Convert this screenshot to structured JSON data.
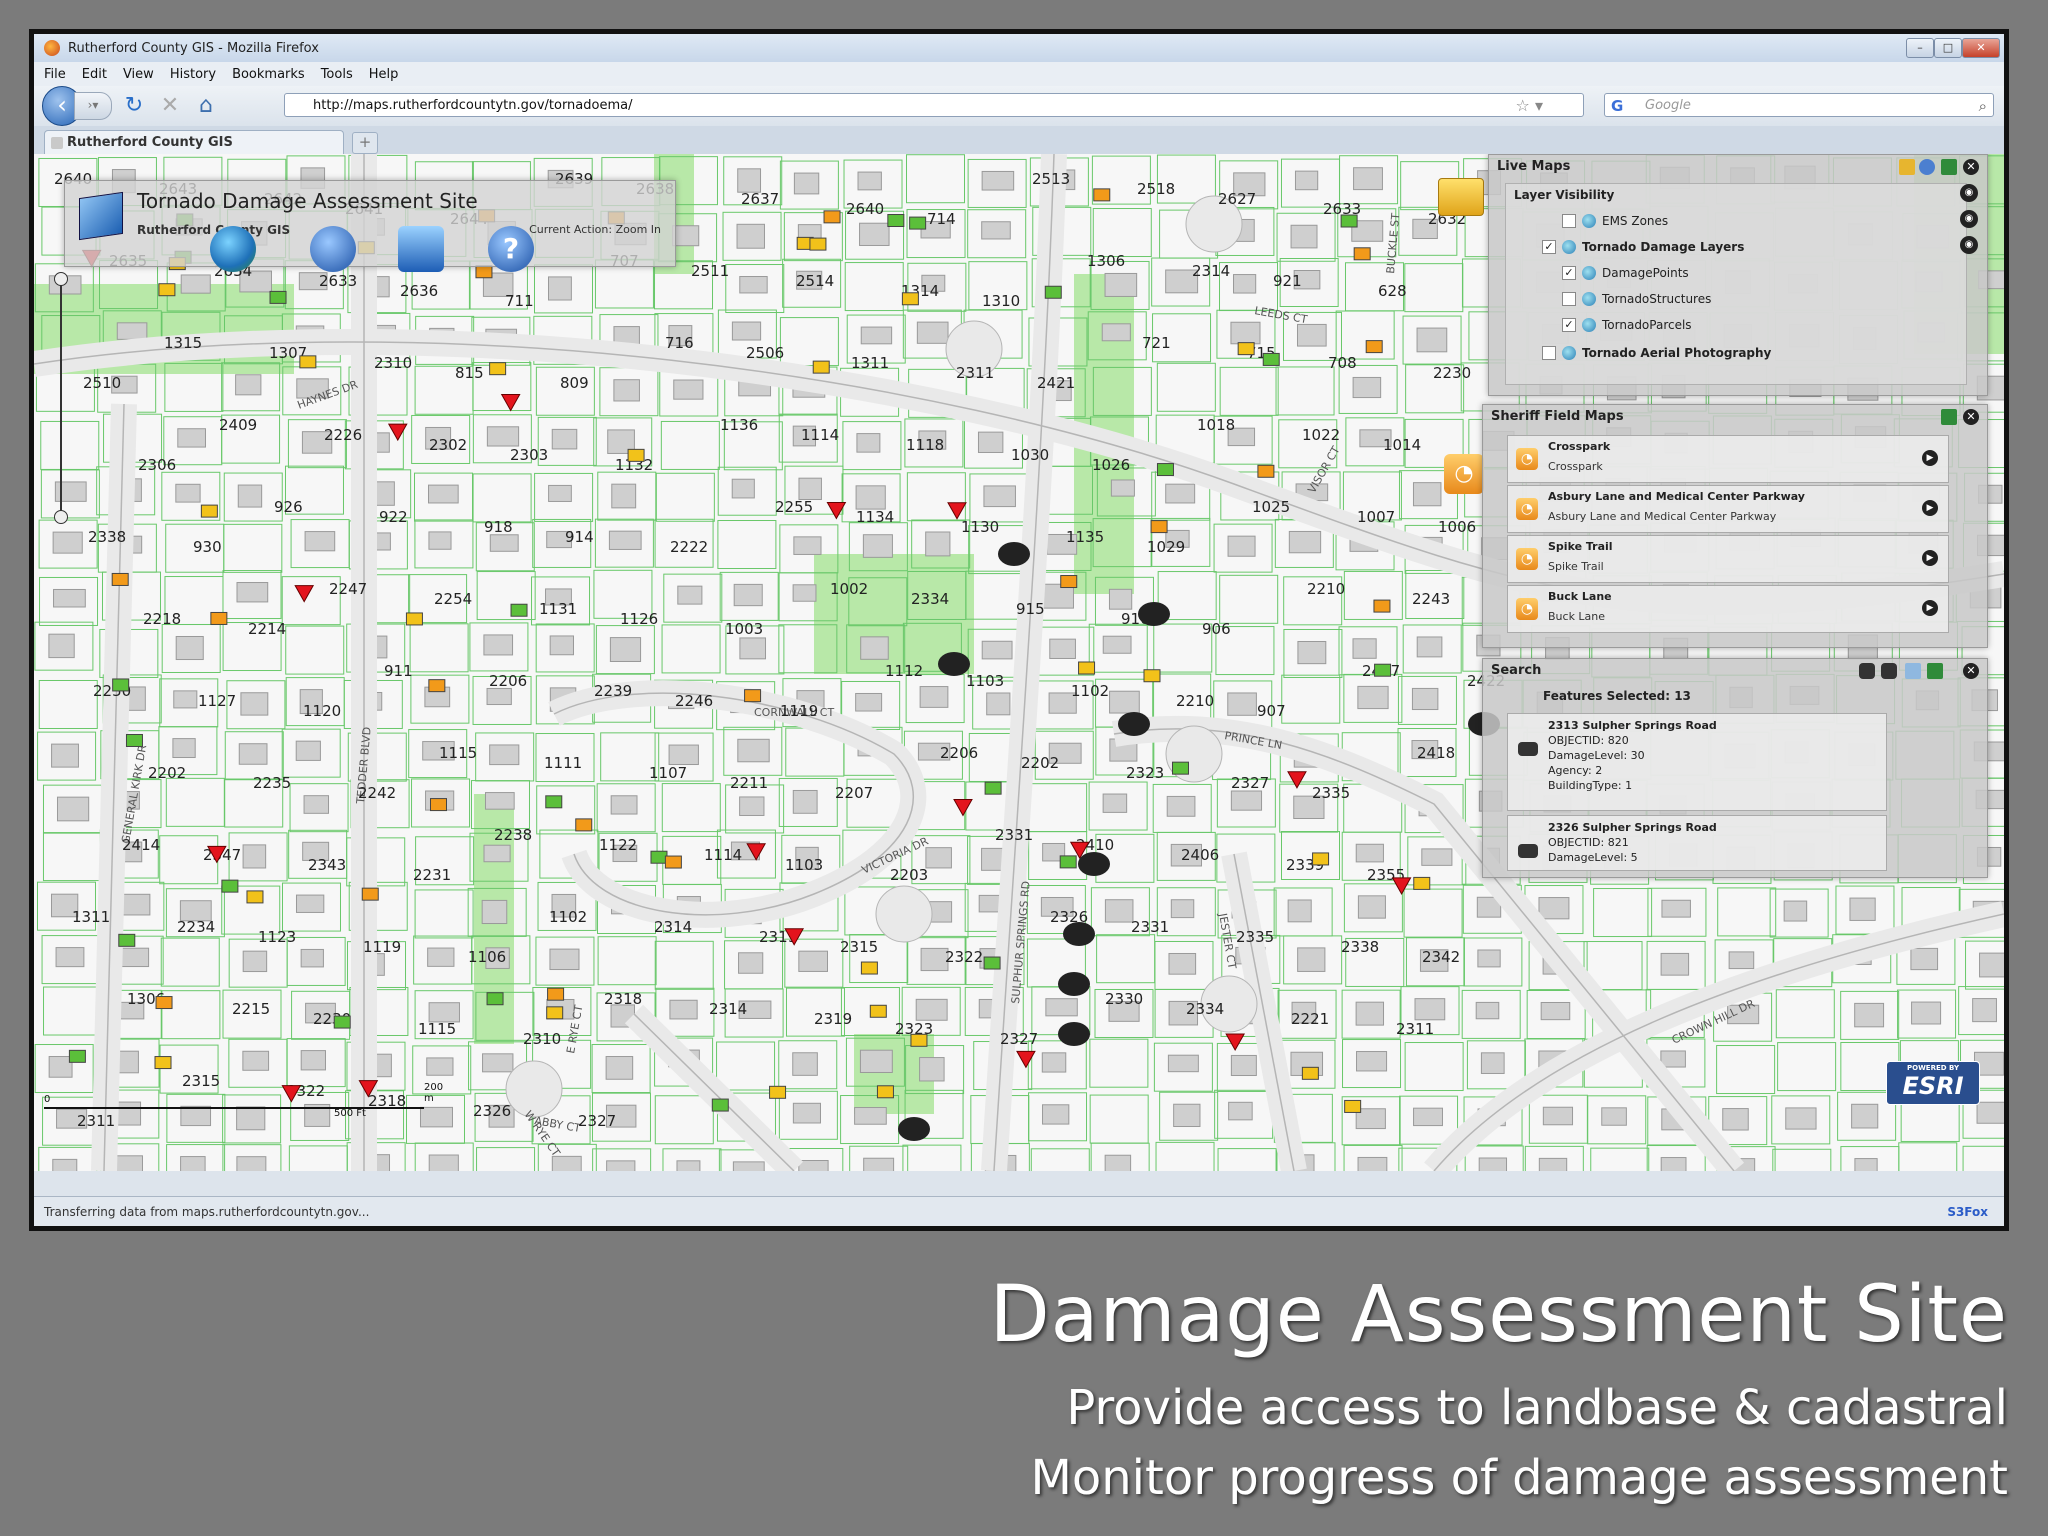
{
  "browser": {
    "window_title": "Rutherford County GIS - Mozilla Firefox",
    "menu": [
      "File",
      "Edit",
      "View",
      "History",
      "Bookmarks",
      "Tools",
      "Help"
    ],
    "url": "http://maps.rutherfordcountytn.gov/tornadoema/",
    "search_placeholder": "Google",
    "tab_label": "Rutherford County GIS",
    "new_tab": "+",
    "status": "Transferring data from maps.rutherfordcountytn.gov...",
    "status_addon": "S3Fox"
  },
  "app": {
    "title": "Tornado Damage Assessment Site",
    "subtitle": "Rutherford County GIS",
    "current_action": "Current Action: Zoom In"
  },
  "live_maps": {
    "title": "Live Maps",
    "layer_visibility": "Layer Visibility",
    "layers": [
      {
        "label": "EMS Zones",
        "checked": false
      },
      {
        "label": "Tornado Damage Layers",
        "checked": true
      },
      {
        "label": "DamagePoints",
        "checked": true
      },
      {
        "label": "TornadoStructures",
        "checked": false
      },
      {
        "label": "TornadoParcels",
        "checked": true
      },
      {
        "label": "Tornado Aerial Photography",
        "checked": false
      }
    ]
  },
  "sheriff_maps": {
    "title": "Sheriff Field Maps",
    "items": [
      {
        "name": "Crosspark",
        "desc": "Crosspark"
      },
      {
        "name": "Asbury Lane and Medical Center Parkway",
        "desc": "Asbury Lane and Medical Center Parkway"
      },
      {
        "name": "Spike Trail",
        "desc": "Spike Trail"
      },
      {
        "name": "Buck Lane",
        "desc": "Buck Lane"
      }
    ]
  },
  "search_panel": {
    "title": "Search",
    "features_selected": "Features Selected: 13",
    "results": [
      {
        "address": "2313 Sulpher Springs Road",
        "lines": [
          "OBJECTID: 820",
          "DamageLevel: 30",
          "Agency: 2",
          "BuildingType: 1"
        ]
      },
      {
        "address": "2326 Sulpher Springs Road",
        "lines": [
          "OBJECTID: 821",
          "DamageLevel: 5"
        ]
      }
    ]
  },
  "map": {
    "streets": [
      "HAYNES DR",
      "GENERAL KIRK DR",
      "TEDDER BLVD",
      "CORNWALL CT",
      "VICTORIA DR",
      "SULPHUR SPRINGS RD",
      "PRINCE LN",
      "JESTER CT",
      "ABBY CT",
      "W RYE CT",
      "E RYE CT",
      "LEEDS CT",
      "VISOR CT",
      "BUCKLE ST",
      "CROWN HILL DR"
    ],
    "parcels": [
      "2640",
      "2643",
      "2642",
      "2641",
      "2644",
      "2639",
      "2638",
      "2637",
      "2640",
      "714",
      "2513",
      "2518",
      "2627",
      "2633",
      "2632",
      "2635",
      "2634",
      "2633",
      "2636",
      "711",
      "707",
      "2511",
      "2514",
      "1314",
      "1310",
      "1306",
      "2314",
      "921",
      "628",
      "2510",
      "1315",
      "1307",
      "2310",
      "815",
      "809",
      "716",
      "2506",
      "1311",
      "2311",
      "2421",
      "721",
      "715",
      "708",
      "2230",
      "2306",
      "2409",
      "2226",
      "2302",
      "2303",
      "1132",
      "1136",
      "1114",
      "1118",
      "1030",
      "1026",
      "1018",
      "1022",
      "1014",
      "2338",
      "930",
      "926",
      "922",
      "918",
      "914",
      "2222",
      "2255",
      "1134",
      "1130",
      "1135",
      "1029",
      "1025",
      "1007",
      "1006",
      "2218",
      "2214",
      "2247",
      "2254",
      "1131",
      "1126",
      "1003",
      "1002",
      "2334",
      "915",
      "910",
      "906",
      "2210",
      "2243",
      "2250",
      "1127",
      "1120",
      "911",
      "2206",
      "2239",
      "2246",
      "1119",
      "1112",
      "1103",
      "1102",
      "2210",
      "907",
      "2407",
      "2422",
      "2202",
      "2235",
      "2242",
      "1115",
      "1111",
      "1107",
      "2211",
      "2207",
      "2206",
      "2202",
      "2323",
      "2327",
      "2335",
      "2418",
      "2414",
      "2347",
      "2343",
      "2231",
      "2238",
      "1122",
      "1114",
      "1103",
      "2203",
      "2331",
      "2410",
      "2406",
      "2339",
      "2355",
      "1311",
      "2234",
      "1123",
      "1119",
      "1106",
      "1102",
      "2314",
      "2319",
      "2315",
      "2322",
      "2326",
      "2331",
      "2335",
      "2338",
      "2342",
      "1306",
      "2215",
      "2230",
      "1115",
      "2310",
      "2318",
      "2314",
      "2319",
      "2323",
      "2327",
      "2330",
      "2334",
      "2221",
      "2311",
      "2311",
      "2315",
      "2322",
      "2318",
      "2326",
      "2327"
    ],
    "scale_labels": [
      "0",
      "200 m",
      "500 Ft"
    ],
    "esri_badge": "ESRI",
    "esri_powered": "POWERED BY"
  },
  "caption": {
    "title": "Damage Assessment Site",
    "line1": "Provide access to landbase & cadastral",
    "line2": "Monitor progress of damage assessment"
  }
}
